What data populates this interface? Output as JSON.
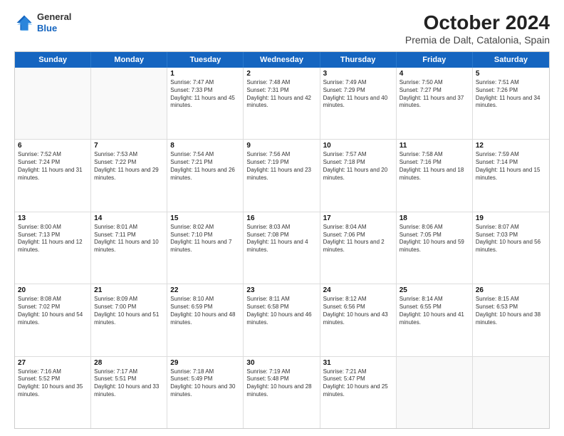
{
  "logo": {
    "general": "General",
    "blue": "Blue"
  },
  "title": "October 2024",
  "subtitle": "Premia de Dalt, Catalonia, Spain",
  "days": [
    "Sunday",
    "Monday",
    "Tuesday",
    "Wednesday",
    "Thursday",
    "Friday",
    "Saturday"
  ],
  "weeks": [
    [
      {
        "day": "",
        "sunrise": "",
        "sunset": "",
        "daylight": ""
      },
      {
        "day": "",
        "sunrise": "",
        "sunset": "",
        "daylight": ""
      },
      {
        "day": "1",
        "sunrise": "Sunrise: 7:47 AM",
        "sunset": "Sunset: 7:33 PM",
        "daylight": "Daylight: 11 hours and 45 minutes."
      },
      {
        "day": "2",
        "sunrise": "Sunrise: 7:48 AM",
        "sunset": "Sunset: 7:31 PM",
        "daylight": "Daylight: 11 hours and 42 minutes."
      },
      {
        "day": "3",
        "sunrise": "Sunrise: 7:49 AM",
        "sunset": "Sunset: 7:29 PM",
        "daylight": "Daylight: 11 hours and 40 minutes."
      },
      {
        "day": "4",
        "sunrise": "Sunrise: 7:50 AM",
        "sunset": "Sunset: 7:27 PM",
        "daylight": "Daylight: 11 hours and 37 minutes."
      },
      {
        "day": "5",
        "sunrise": "Sunrise: 7:51 AM",
        "sunset": "Sunset: 7:26 PM",
        "daylight": "Daylight: 11 hours and 34 minutes."
      }
    ],
    [
      {
        "day": "6",
        "sunrise": "Sunrise: 7:52 AM",
        "sunset": "Sunset: 7:24 PM",
        "daylight": "Daylight: 11 hours and 31 minutes."
      },
      {
        "day": "7",
        "sunrise": "Sunrise: 7:53 AM",
        "sunset": "Sunset: 7:22 PM",
        "daylight": "Daylight: 11 hours and 29 minutes."
      },
      {
        "day": "8",
        "sunrise": "Sunrise: 7:54 AM",
        "sunset": "Sunset: 7:21 PM",
        "daylight": "Daylight: 11 hours and 26 minutes."
      },
      {
        "day": "9",
        "sunrise": "Sunrise: 7:56 AM",
        "sunset": "Sunset: 7:19 PM",
        "daylight": "Daylight: 11 hours and 23 minutes."
      },
      {
        "day": "10",
        "sunrise": "Sunrise: 7:57 AM",
        "sunset": "Sunset: 7:18 PM",
        "daylight": "Daylight: 11 hours and 20 minutes."
      },
      {
        "day": "11",
        "sunrise": "Sunrise: 7:58 AM",
        "sunset": "Sunset: 7:16 PM",
        "daylight": "Daylight: 11 hours and 18 minutes."
      },
      {
        "day": "12",
        "sunrise": "Sunrise: 7:59 AM",
        "sunset": "Sunset: 7:14 PM",
        "daylight": "Daylight: 11 hours and 15 minutes."
      }
    ],
    [
      {
        "day": "13",
        "sunrise": "Sunrise: 8:00 AM",
        "sunset": "Sunset: 7:13 PM",
        "daylight": "Daylight: 11 hours and 12 minutes."
      },
      {
        "day": "14",
        "sunrise": "Sunrise: 8:01 AM",
        "sunset": "Sunset: 7:11 PM",
        "daylight": "Daylight: 11 hours and 10 minutes."
      },
      {
        "day": "15",
        "sunrise": "Sunrise: 8:02 AM",
        "sunset": "Sunset: 7:10 PM",
        "daylight": "Daylight: 11 hours and 7 minutes."
      },
      {
        "day": "16",
        "sunrise": "Sunrise: 8:03 AM",
        "sunset": "Sunset: 7:08 PM",
        "daylight": "Daylight: 11 hours and 4 minutes."
      },
      {
        "day": "17",
        "sunrise": "Sunrise: 8:04 AM",
        "sunset": "Sunset: 7:06 PM",
        "daylight": "Daylight: 11 hours and 2 minutes."
      },
      {
        "day": "18",
        "sunrise": "Sunrise: 8:06 AM",
        "sunset": "Sunset: 7:05 PM",
        "daylight": "Daylight: 10 hours and 59 minutes."
      },
      {
        "day": "19",
        "sunrise": "Sunrise: 8:07 AM",
        "sunset": "Sunset: 7:03 PM",
        "daylight": "Daylight: 10 hours and 56 minutes."
      }
    ],
    [
      {
        "day": "20",
        "sunrise": "Sunrise: 8:08 AM",
        "sunset": "Sunset: 7:02 PM",
        "daylight": "Daylight: 10 hours and 54 minutes."
      },
      {
        "day": "21",
        "sunrise": "Sunrise: 8:09 AM",
        "sunset": "Sunset: 7:00 PM",
        "daylight": "Daylight: 10 hours and 51 minutes."
      },
      {
        "day": "22",
        "sunrise": "Sunrise: 8:10 AM",
        "sunset": "Sunset: 6:59 PM",
        "daylight": "Daylight: 10 hours and 48 minutes."
      },
      {
        "day": "23",
        "sunrise": "Sunrise: 8:11 AM",
        "sunset": "Sunset: 6:58 PM",
        "daylight": "Daylight: 10 hours and 46 minutes."
      },
      {
        "day": "24",
        "sunrise": "Sunrise: 8:12 AM",
        "sunset": "Sunset: 6:56 PM",
        "daylight": "Daylight: 10 hours and 43 minutes."
      },
      {
        "day": "25",
        "sunrise": "Sunrise: 8:14 AM",
        "sunset": "Sunset: 6:55 PM",
        "daylight": "Daylight: 10 hours and 41 minutes."
      },
      {
        "day": "26",
        "sunrise": "Sunrise: 8:15 AM",
        "sunset": "Sunset: 6:53 PM",
        "daylight": "Daylight: 10 hours and 38 minutes."
      }
    ],
    [
      {
        "day": "27",
        "sunrise": "Sunrise: 7:16 AM",
        "sunset": "Sunset: 5:52 PM",
        "daylight": "Daylight: 10 hours and 35 minutes."
      },
      {
        "day": "28",
        "sunrise": "Sunrise: 7:17 AM",
        "sunset": "Sunset: 5:51 PM",
        "daylight": "Daylight: 10 hours and 33 minutes."
      },
      {
        "day": "29",
        "sunrise": "Sunrise: 7:18 AM",
        "sunset": "Sunset: 5:49 PM",
        "daylight": "Daylight: 10 hours and 30 minutes."
      },
      {
        "day": "30",
        "sunrise": "Sunrise: 7:19 AM",
        "sunset": "Sunset: 5:48 PM",
        "daylight": "Daylight: 10 hours and 28 minutes."
      },
      {
        "day": "31",
        "sunrise": "Sunrise: 7:21 AM",
        "sunset": "Sunset: 5:47 PM",
        "daylight": "Daylight: 10 hours and 25 minutes."
      },
      {
        "day": "",
        "sunrise": "",
        "sunset": "",
        "daylight": ""
      },
      {
        "day": "",
        "sunrise": "",
        "sunset": "",
        "daylight": ""
      }
    ]
  ]
}
